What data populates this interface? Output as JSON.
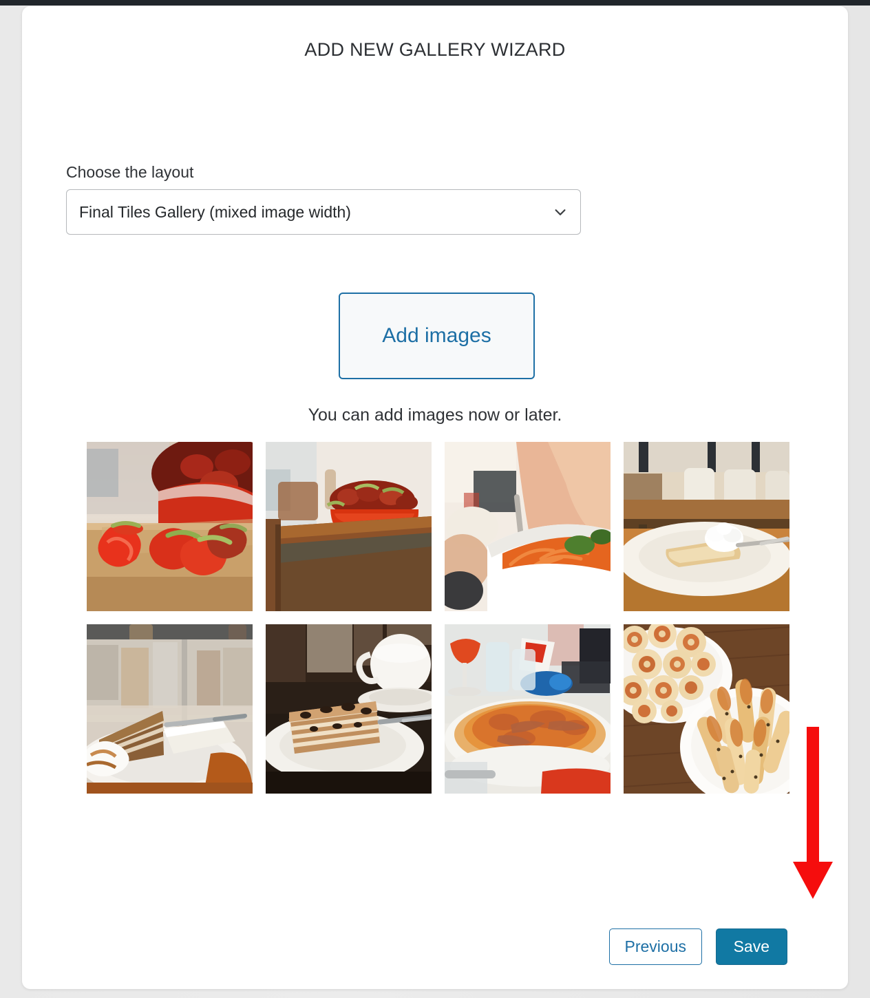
{
  "window": {
    "title": "ADD NEW GALLERY WIZARD",
    "card_background": "#ffffff",
    "page_background": "#ededed",
    "top_bar_color": "#21262b"
  },
  "layout_field": {
    "label": "Choose the layout",
    "selected_value": "Final Tiles Gallery (mixed image width)",
    "chevron_icon": "chevron-down-icon"
  },
  "add_images": {
    "label": "Add images",
    "accent_color": "#1d6fa5"
  },
  "hint": {
    "text": "You can add images now or later."
  },
  "gallery": {
    "columns": 4,
    "rows": 2,
    "thumbnails": [
      {
        "index": 1,
        "alt": "Sliced strawberries on a wooden cutting board with a red bowl of strawberries behind",
        "palette": [
          "#cdb9a4",
          "#d94126",
          "#e8e1d6",
          "#b98a53"
        ]
      },
      {
        "index": 2,
        "alt": "Red bowl full of strawberries on the corner of a wooden table",
        "palette": [
          "#efe9e2",
          "#cf3a1d",
          "#8a5530",
          "#5d4330"
        ]
      },
      {
        "index": 3,
        "alt": "White bowl of carrot and greens salad held by a person with a fork",
        "palette": [
          "#f2ece6",
          "#e8833f",
          "#5e8f3d",
          "#e3b39a"
        ]
      },
      {
        "index": 4,
        "alt": "Slice of strudel with whipped cream on a white plate in a restaurant",
        "palette": [
          "#cfa16a",
          "#f4efe8",
          "#8d6a48",
          "#dcd2c4"
        ]
      },
      {
        "index": 5,
        "alt": "Slice of honey layer cake with cream on a plate at a street cafe",
        "palette": [
          "#d9cec2",
          "#8a5e3c",
          "#f3eee8",
          "#b4651f"
        ]
      },
      {
        "index": 6,
        "alt": "Layered cake slice on a white plate next to a coffee cup",
        "palette": [
          "#3a2f28",
          "#c99a6d",
          "#f1ece4",
          "#1d1713"
        ]
      },
      {
        "index": 7,
        "alt": "Thin crust pizza on a white plate with drinks in the background",
        "palette": [
          "#e9e6e0",
          "#d5762e",
          "#e8c48a",
          "#2b6fa8"
        ]
      },
      {
        "index": 8,
        "alt": "Pastry pinwheels and breadsticks on white plates on a wooden table",
        "palette": [
          "#6b4328",
          "#f2e4cd",
          "#d79449",
          "#ffffff"
        ]
      }
    ]
  },
  "annotation": {
    "arrow_icon": "down-arrow-annotation",
    "color": "#f50d0d",
    "points_to": "save-button"
  },
  "footer": {
    "previous_label": "Previous",
    "save_label": "Save",
    "save_background": "#1179a3",
    "previous_border": "#1d6fa5"
  }
}
